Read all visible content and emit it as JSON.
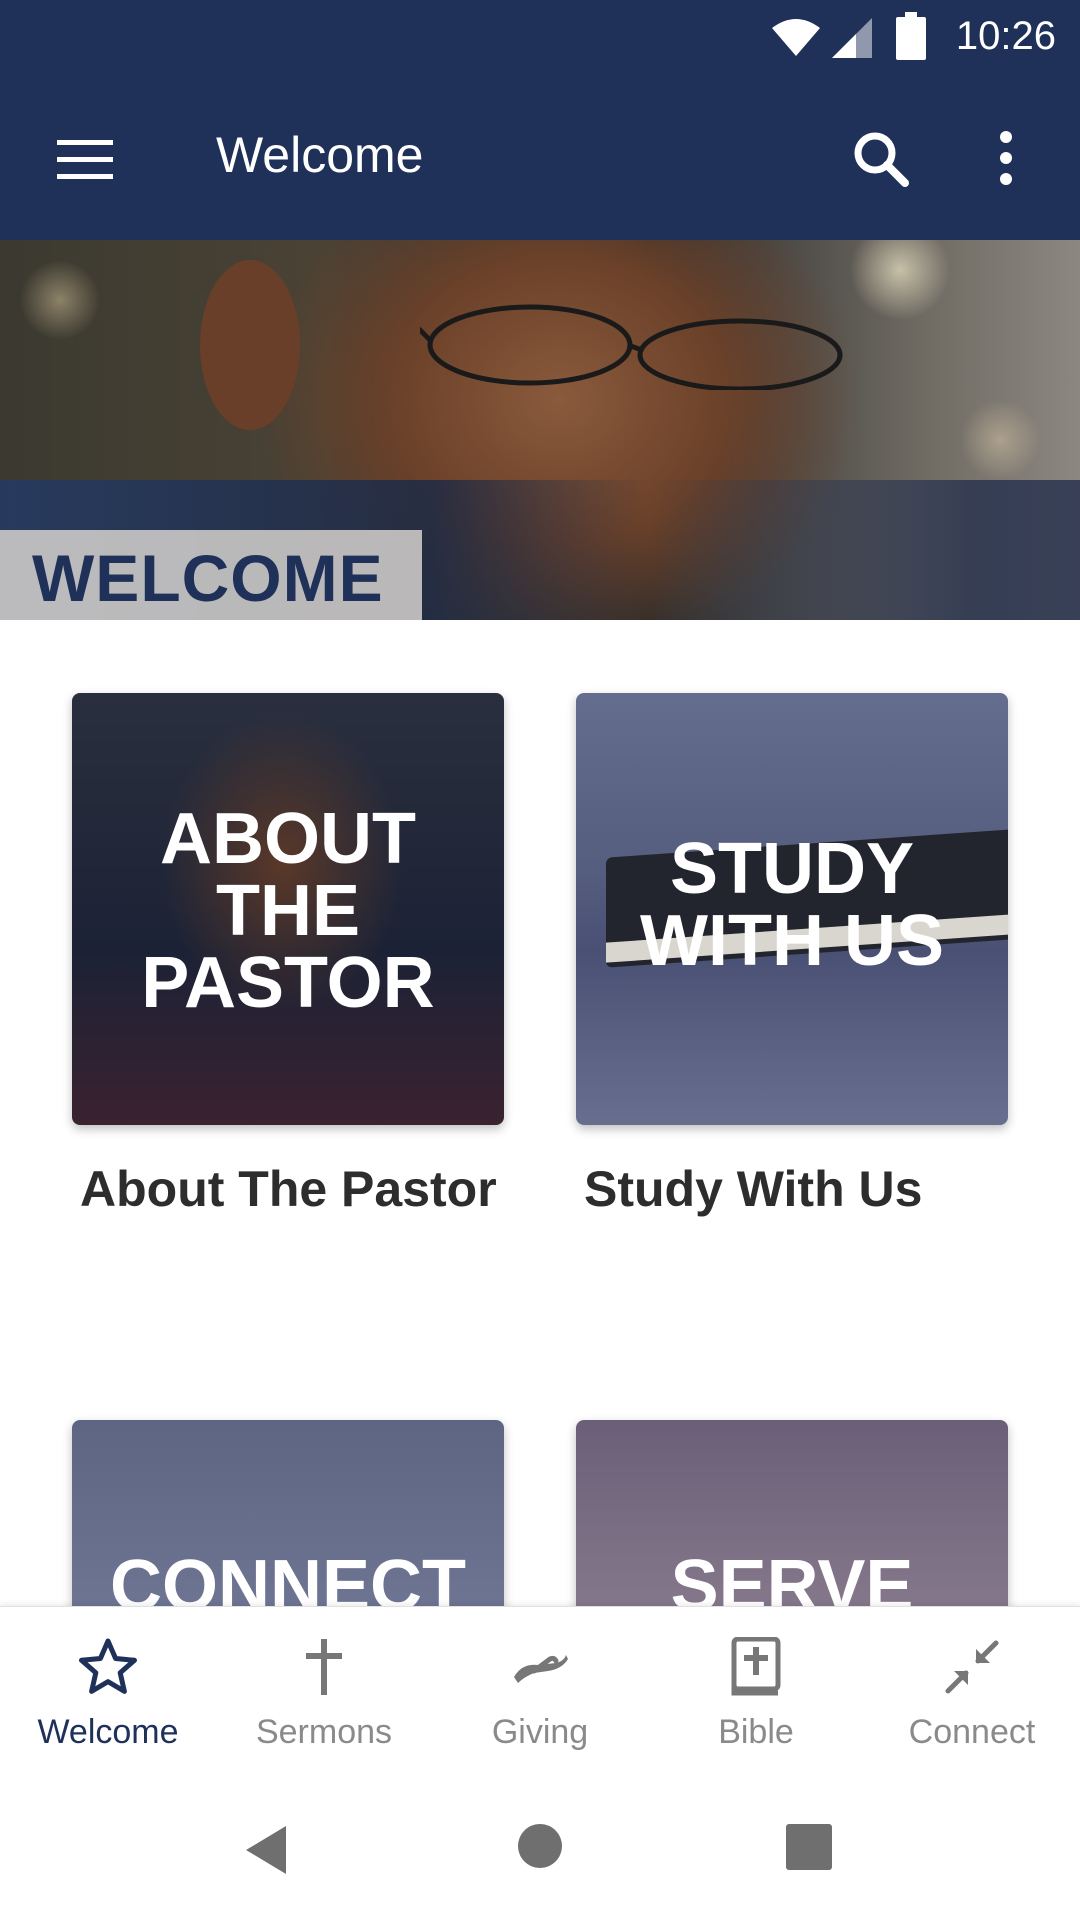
{
  "status_bar": {
    "time": "10:26",
    "icons": [
      "wifi-icon",
      "cell-signal-icon",
      "battery-icon"
    ]
  },
  "app_bar": {
    "title": "Welcome",
    "icons": [
      "menu-icon",
      "search-icon",
      "more-vert-icon"
    ]
  },
  "hero": {
    "label": "WELCOME"
  },
  "tiles": [
    {
      "overlay_lines": [
        "ABOUT",
        "THE",
        "PASTOR"
      ],
      "caption": "About The Pastor"
    },
    {
      "overlay_lines": [
        "STUDY",
        "WITH US"
      ],
      "caption": "Study With Us"
    },
    {
      "overlay_lines": [
        "CONNECT"
      ],
      "caption": ""
    },
    {
      "overlay_lines": [
        "SERVE"
      ],
      "caption": ""
    }
  ],
  "bottom_nav": {
    "active_index": 0,
    "items": [
      {
        "label": "Welcome",
        "icon": "star-icon"
      },
      {
        "label": "Sermons",
        "icon": "cross-icon"
      },
      {
        "label": "Giving",
        "icon": "giving-hand-icon"
      },
      {
        "label": "Bible",
        "icon": "bible-icon"
      },
      {
        "label": "Connect",
        "icon": "connect-arrows-icon"
      }
    ]
  },
  "colors": {
    "primary": "#1f3159",
    "nav_inactive": "#8a8a8a",
    "caption_text": "#2d2d2d"
  }
}
